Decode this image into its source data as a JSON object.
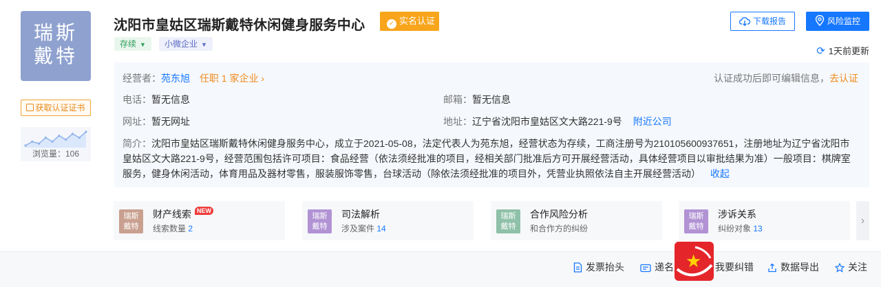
{
  "company": {
    "logo_text": "瑞斯戴特",
    "name": "沈阳市皇姑区瑞斯戴特休闲健身服务中心",
    "verified_label": "实名认证",
    "status_tag": "存续",
    "size_tag": "小微企业"
  },
  "sidebar": {
    "cert_button": "获取认证证书",
    "views_label": "浏览量：",
    "views_count": "106",
    "views_trend": [
      3,
      5,
      4,
      7,
      5,
      8,
      6,
      9,
      7,
      10
    ]
  },
  "actions": {
    "report_button": "下载报告",
    "monitor_button": "风险监控",
    "updated": "1天前更新"
  },
  "info": {
    "operator_label": "经营者：",
    "operator_name": "苑东旭",
    "operator_roles": "任职 1 家企业",
    "edit_prompt": "认证成功后即可编辑信息，",
    "edit_link": "去认证",
    "phone_label": "电话：",
    "phone": "暂无信息",
    "email_label": "邮箱：",
    "email": "暂无信息",
    "website_label": "网址：",
    "website": "暂无网址",
    "address_label": "地址：",
    "address": "辽宁省沈阳市皇姑区文大路221-9号",
    "nearby_link": "附近公司",
    "intro_label": "简介：",
    "intro": "沈阳市皇姑区瑞斯戴特休闲健身服务中心，成立于2021-05-08，法定代表人为苑东旭，经营状态为存续，工商注册号为210105600937651，注册地址为辽宁省沈阳市皇姑区文大路221-9号，经营范围包括许可项目：食品经营（依法须经批准的项目，经相关部门批准后方可开展经营活动，具体经营项目以审批结果为准）一般项目：棋牌室服务，健身休闲活动，体育用品及器材零售，服装服饰零售，台球活动（除依法须经批准的项目外，凭营业执照依法自主开展经营活动）",
    "collapse_link": "收起"
  },
  "cards": [
    {
      "icon_text": "瑞斯戴特",
      "color": "#c9a08f",
      "title": "财产线索",
      "badge": "NEW",
      "sub_label": "线索数量",
      "sub_value": "2"
    },
    {
      "icon_text": "瑞斯戴特",
      "color": "#b193d4",
      "title": "司法解析",
      "badge": "",
      "sub_label": "涉及案件",
      "sub_value": "14"
    },
    {
      "icon_text": "瑞斯戴特",
      "color": "#8fc1a8",
      "title": "合作风险分析",
      "badge": "",
      "sub_label": "和合作方的纠纷",
      "sub_value": ""
    },
    {
      "icon_text": "瑞斯戴特",
      "color": "#b193d4",
      "title": "涉诉关系",
      "badge": "",
      "sub_label": "纠纷对象",
      "sub_value": "13"
    }
  ],
  "bottom_bar": {
    "invoice": "发票抬头",
    "card": "递名片",
    "error": "我要纠错",
    "data": "数据导出",
    "follow": "关注"
  }
}
